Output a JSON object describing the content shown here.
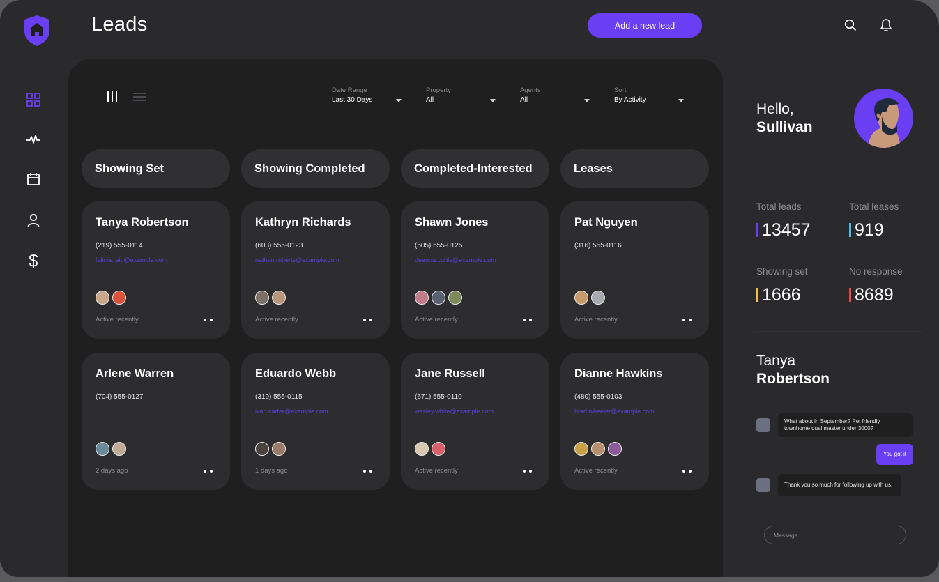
{
  "header": {
    "title": "Leads",
    "add_button": "Add a new lead"
  },
  "sidebar": {
    "items": [
      {
        "icon": "dashboard-grid-icon",
        "active": true
      },
      {
        "icon": "activity-icon",
        "active": false
      },
      {
        "icon": "calendar-icon",
        "active": false
      },
      {
        "icon": "user-icon",
        "active": false
      },
      {
        "icon": "dollar-icon",
        "active": false
      }
    ]
  },
  "filters": [
    {
      "label": "Date Range",
      "value": "Last 30 Days"
    },
    {
      "label": "Property",
      "value": "All"
    },
    {
      "label": "Agents",
      "value": "All"
    },
    {
      "label": "Sort",
      "value": "By Activity"
    }
  ],
  "columns": [
    {
      "title": "Showing Set",
      "cards": [
        {
          "name": "Tanya Robertson",
          "phone": "(219) 555-0114",
          "email": "felicia.reid@example.com",
          "status": "Active recently"
        },
        {
          "name": "Arlene Warren",
          "phone": "(704) 555-0127",
          "email": "",
          "status": "2 days ago"
        }
      ]
    },
    {
      "title": "Showing Completed",
      "cards": [
        {
          "name": "Kathryn Richards",
          "phone": "(603) 555-0123",
          "email": "nathan.roberts@example.com",
          "status": "Active recently"
        },
        {
          "name": "Eduardo Webb",
          "phone": "(319) 555-0115",
          "email": "ivan.carter@example.com",
          "status": "1 days ago"
        }
      ]
    },
    {
      "title": "Completed-Interested",
      "cards": [
        {
          "name": "Shawn Jones",
          "phone": "(505) 555-0125",
          "email": "deanna.curtis@example.com",
          "status": "Active recently"
        },
        {
          "name": "Jane Russell",
          "phone": "(671) 555-0110",
          "email": "wesley.white@example.com",
          "status": "Active recently"
        }
      ]
    },
    {
      "title": "Leases",
      "cards": [
        {
          "name": "Pat Nguyen",
          "phone": "(316) 555-0116",
          "email": "",
          "status": "Active recently"
        },
        {
          "name": "Dianne Hawkins",
          "phone": "(480) 555-0103",
          "email": "brad.wheeler@example.com",
          "status": "Active recently"
        }
      ]
    }
  ],
  "greeting": {
    "line1": "Hello,",
    "name": "Sullivan"
  },
  "stats": [
    {
      "label": "Total leads",
      "value": "13457",
      "color": "#6a3ff4"
    },
    {
      "label": "Total leases",
      "value": "919",
      "color": "#4fb8e8"
    },
    {
      "label": "Showing set",
      "value": "1666",
      "color": "#f0c24a"
    },
    {
      "label": "No response",
      "value": "8689",
      "color": "#e8484e"
    }
  ],
  "chat": {
    "contact_first": "Tanya",
    "contact_last": "Robertson",
    "messages": [
      {
        "from": "them",
        "text": "What about in September? Pet friendly townhome dual master under 3000?"
      },
      {
        "from": "me",
        "text": "You got it"
      },
      {
        "from": "them",
        "text": "Thank you so much for following up with us."
      }
    ],
    "input_placeholder": "Message"
  },
  "colors": {
    "accent": "#6a3ff4",
    "background": "#2a2a2c",
    "board": "#1f1f20",
    "card": "#2d2d2f"
  }
}
